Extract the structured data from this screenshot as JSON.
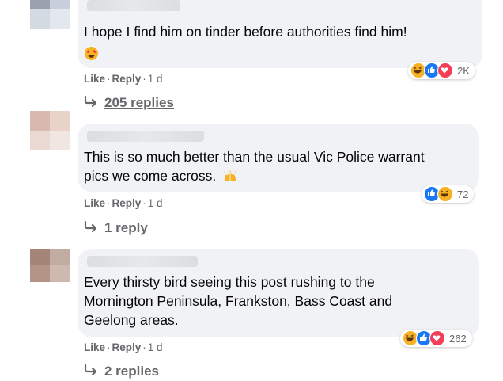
{
  "comments": [
    {
      "text_lines": [
        "I hope I find him on tinder before authorities find him!"
      ],
      "emoji": "heart-eyes",
      "reaction_count": "2K",
      "actions": {
        "like": "Like",
        "reply": "Reply",
        "time": "1 d"
      },
      "replies": "205 replies"
    },
    {
      "text_lines": [
        "This is so much better than the usual Vic Police warrant",
        "pics we come across."
      ],
      "emoji": "raising-hands",
      "reaction_count": "72",
      "actions": {
        "like": "Like",
        "reply": "Reply",
        "time": "1 d"
      },
      "replies": "1 reply"
    },
    {
      "text_lines": [
        "Every thirsty bird seeing this post rushing to the",
        "Mornington Peninsula, Frankston, Bass Coast and",
        "Geelong areas."
      ],
      "reaction_count": "262",
      "actions": {
        "like": "Like",
        "reply": "Reply",
        "time": "1 d"
      },
      "replies": "2 replies"
    }
  ],
  "colors": {
    "bubble": "#f0f2f5",
    "secondary_text": "#65676b",
    "haha": "#f7b125",
    "like": "#1877f2",
    "love": "#f33e58"
  }
}
